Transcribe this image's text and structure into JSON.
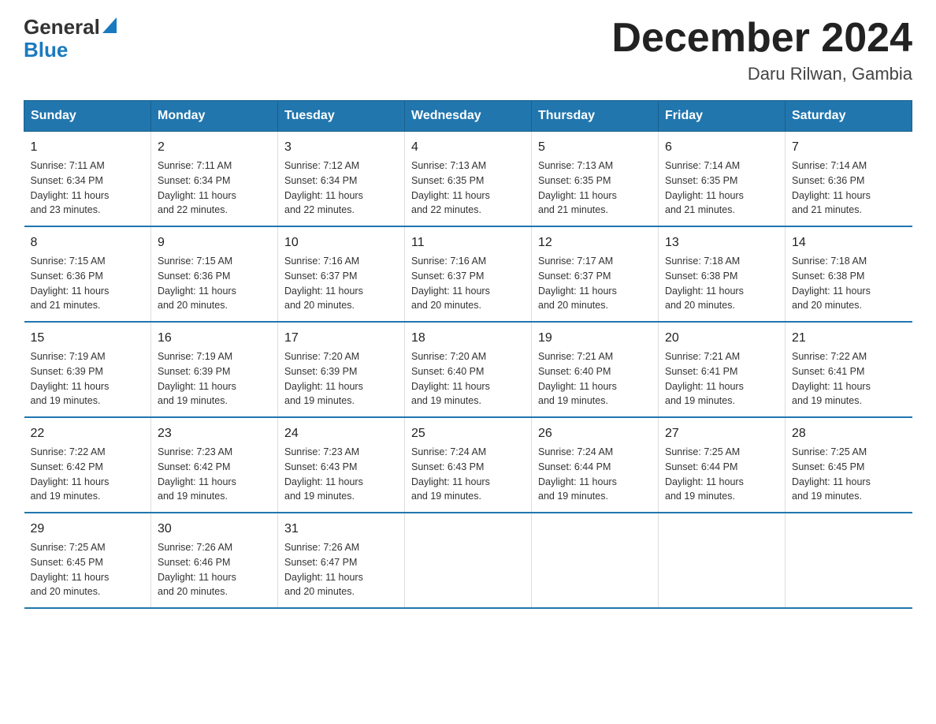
{
  "logo": {
    "text1": "General",
    "text2": "Blue"
  },
  "title": "December 2024",
  "subtitle": "Daru Rilwan, Gambia",
  "days_of_week": [
    "Sunday",
    "Monday",
    "Tuesday",
    "Wednesday",
    "Thursday",
    "Friday",
    "Saturday"
  ],
  "weeks": [
    [
      {
        "day": "1",
        "info": "Sunrise: 7:11 AM\nSunset: 6:34 PM\nDaylight: 11 hours\nand 23 minutes."
      },
      {
        "day": "2",
        "info": "Sunrise: 7:11 AM\nSunset: 6:34 PM\nDaylight: 11 hours\nand 22 minutes."
      },
      {
        "day": "3",
        "info": "Sunrise: 7:12 AM\nSunset: 6:34 PM\nDaylight: 11 hours\nand 22 minutes."
      },
      {
        "day": "4",
        "info": "Sunrise: 7:13 AM\nSunset: 6:35 PM\nDaylight: 11 hours\nand 22 minutes."
      },
      {
        "day": "5",
        "info": "Sunrise: 7:13 AM\nSunset: 6:35 PM\nDaylight: 11 hours\nand 21 minutes."
      },
      {
        "day": "6",
        "info": "Sunrise: 7:14 AM\nSunset: 6:35 PM\nDaylight: 11 hours\nand 21 minutes."
      },
      {
        "day": "7",
        "info": "Sunrise: 7:14 AM\nSunset: 6:36 PM\nDaylight: 11 hours\nand 21 minutes."
      }
    ],
    [
      {
        "day": "8",
        "info": "Sunrise: 7:15 AM\nSunset: 6:36 PM\nDaylight: 11 hours\nand 21 minutes."
      },
      {
        "day": "9",
        "info": "Sunrise: 7:15 AM\nSunset: 6:36 PM\nDaylight: 11 hours\nand 20 minutes."
      },
      {
        "day": "10",
        "info": "Sunrise: 7:16 AM\nSunset: 6:37 PM\nDaylight: 11 hours\nand 20 minutes."
      },
      {
        "day": "11",
        "info": "Sunrise: 7:16 AM\nSunset: 6:37 PM\nDaylight: 11 hours\nand 20 minutes."
      },
      {
        "day": "12",
        "info": "Sunrise: 7:17 AM\nSunset: 6:37 PM\nDaylight: 11 hours\nand 20 minutes."
      },
      {
        "day": "13",
        "info": "Sunrise: 7:18 AM\nSunset: 6:38 PM\nDaylight: 11 hours\nand 20 minutes."
      },
      {
        "day": "14",
        "info": "Sunrise: 7:18 AM\nSunset: 6:38 PM\nDaylight: 11 hours\nand 20 minutes."
      }
    ],
    [
      {
        "day": "15",
        "info": "Sunrise: 7:19 AM\nSunset: 6:39 PM\nDaylight: 11 hours\nand 19 minutes."
      },
      {
        "day": "16",
        "info": "Sunrise: 7:19 AM\nSunset: 6:39 PM\nDaylight: 11 hours\nand 19 minutes."
      },
      {
        "day": "17",
        "info": "Sunrise: 7:20 AM\nSunset: 6:39 PM\nDaylight: 11 hours\nand 19 minutes."
      },
      {
        "day": "18",
        "info": "Sunrise: 7:20 AM\nSunset: 6:40 PM\nDaylight: 11 hours\nand 19 minutes."
      },
      {
        "day": "19",
        "info": "Sunrise: 7:21 AM\nSunset: 6:40 PM\nDaylight: 11 hours\nand 19 minutes."
      },
      {
        "day": "20",
        "info": "Sunrise: 7:21 AM\nSunset: 6:41 PM\nDaylight: 11 hours\nand 19 minutes."
      },
      {
        "day": "21",
        "info": "Sunrise: 7:22 AM\nSunset: 6:41 PM\nDaylight: 11 hours\nand 19 minutes."
      }
    ],
    [
      {
        "day": "22",
        "info": "Sunrise: 7:22 AM\nSunset: 6:42 PM\nDaylight: 11 hours\nand 19 minutes."
      },
      {
        "day": "23",
        "info": "Sunrise: 7:23 AM\nSunset: 6:42 PM\nDaylight: 11 hours\nand 19 minutes."
      },
      {
        "day": "24",
        "info": "Sunrise: 7:23 AM\nSunset: 6:43 PM\nDaylight: 11 hours\nand 19 minutes."
      },
      {
        "day": "25",
        "info": "Sunrise: 7:24 AM\nSunset: 6:43 PM\nDaylight: 11 hours\nand 19 minutes."
      },
      {
        "day": "26",
        "info": "Sunrise: 7:24 AM\nSunset: 6:44 PM\nDaylight: 11 hours\nand 19 minutes."
      },
      {
        "day": "27",
        "info": "Sunrise: 7:25 AM\nSunset: 6:44 PM\nDaylight: 11 hours\nand 19 minutes."
      },
      {
        "day": "28",
        "info": "Sunrise: 7:25 AM\nSunset: 6:45 PM\nDaylight: 11 hours\nand 19 minutes."
      }
    ],
    [
      {
        "day": "29",
        "info": "Sunrise: 7:25 AM\nSunset: 6:45 PM\nDaylight: 11 hours\nand 20 minutes."
      },
      {
        "day": "30",
        "info": "Sunrise: 7:26 AM\nSunset: 6:46 PM\nDaylight: 11 hours\nand 20 minutes."
      },
      {
        "day": "31",
        "info": "Sunrise: 7:26 AM\nSunset: 6:47 PM\nDaylight: 11 hours\nand 20 minutes."
      },
      {
        "day": "",
        "info": ""
      },
      {
        "day": "",
        "info": ""
      },
      {
        "day": "",
        "info": ""
      },
      {
        "day": "",
        "info": ""
      }
    ]
  ]
}
